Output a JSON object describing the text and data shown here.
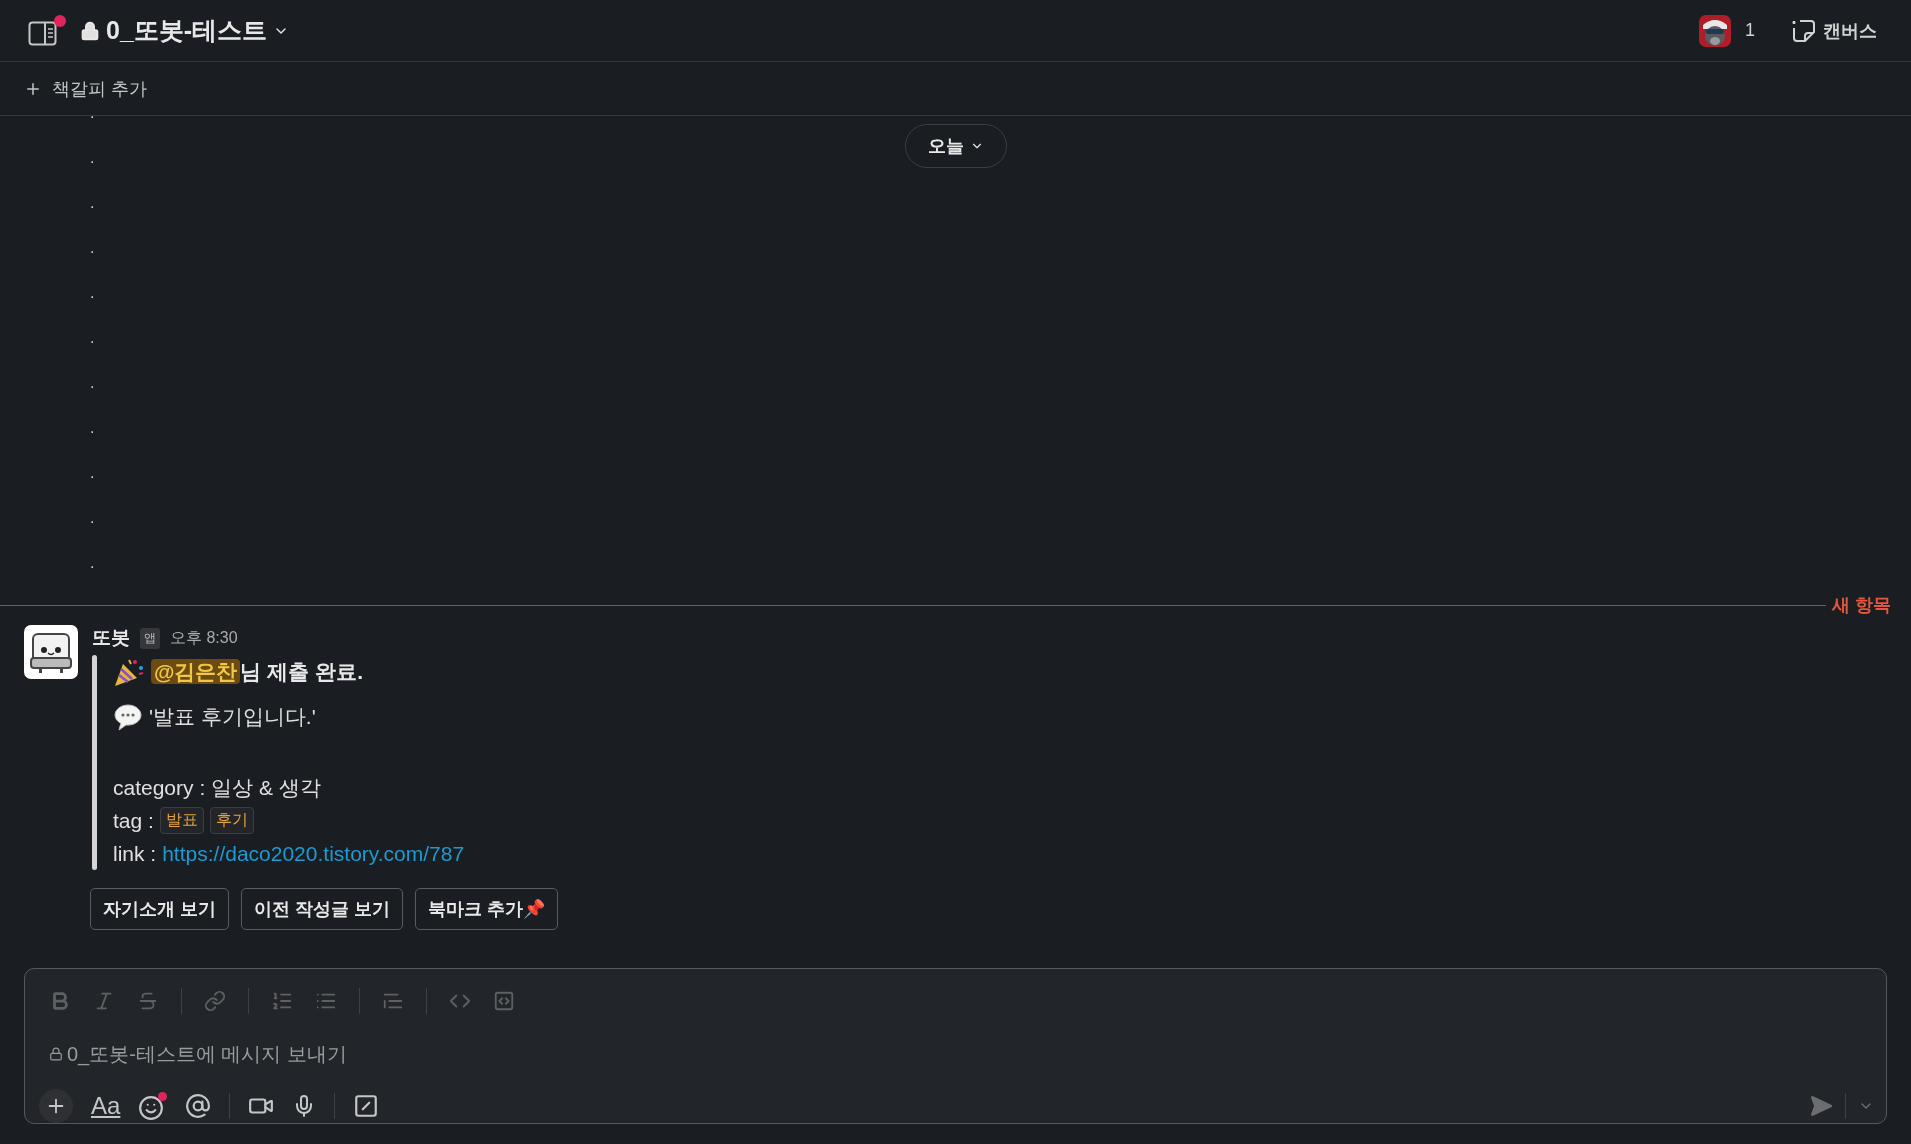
{
  "header": {
    "channel_name": "0_또봇-테스트",
    "member_count": "1",
    "canvas_label": "캔버스",
    "sidebar_unread": true
  },
  "bookmark_bar": {
    "label": "책갈피 추가"
  },
  "date_pill": {
    "label": "오늘"
  },
  "earlier_messages": [
    ".",
    ".",
    ".",
    ".",
    ".",
    ".",
    ".",
    ".",
    ".",
    ".",
    "."
  ],
  "new_divider": {
    "label": "새 항목"
  },
  "message": {
    "sender": "또봇",
    "badge": "앱",
    "time": "오후 8:30",
    "mention": "@김은찬",
    "headline_rest": "님 제출 완료.",
    "quote": "'발표 후기입니다.'",
    "category_line": "category : 일상 & 생각",
    "tag_label": "tag :",
    "tags": [
      "발표",
      "후기"
    ],
    "link_label": "link :",
    "link": "https://daco2020.tistory.com/787"
  },
  "buttons": [
    "자기소개 보기",
    "이전 작성글 보기",
    "북마크 추가📌"
  ],
  "composer": {
    "placeholder": "0_또봇-테스트에 메시지 보내기",
    "format_label": "Aa",
    "emoji_unread": true
  }
}
